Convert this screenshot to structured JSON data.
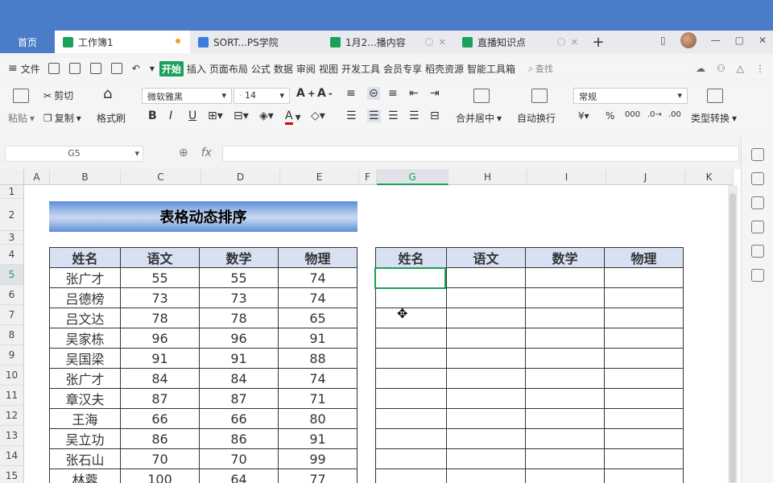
{
  "tabs": {
    "home": "首页",
    "active": "工作簿1",
    "t2": "SORT...PS学院",
    "t3": "1月2...播内容",
    "t4": "直播知识点"
  },
  "menu": {
    "file": "文件",
    "start": "开始",
    "items": [
      "插入",
      "页面布局",
      "公式",
      "数据",
      "审阅",
      "视图",
      "开发工具",
      "会员专享",
      "稻壳资源",
      "智能工具箱"
    ],
    "search": "查找"
  },
  "ribbon": {
    "cut": "剪切",
    "paste": "粘贴",
    "copy": "复制",
    "format_painter": "格式刷",
    "font": "微软雅黑",
    "size": "14",
    "merge": "合并居中",
    "wrap": "自动换行",
    "number_format": "常规",
    "convert": "类型转换",
    "bold": "B",
    "italic": "I",
    "underline": "U"
  },
  "formula": {
    "namebox": "G5",
    "fx": "fx"
  },
  "columns": [
    "A",
    "B",
    "C",
    "D",
    "E",
    "F",
    "G",
    "H",
    "I",
    "J",
    "K"
  ],
  "rows": [
    "1",
    "2",
    "3",
    "4",
    "5",
    "6",
    "7",
    "8",
    "9",
    "10",
    "11",
    "12",
    "13",
    "14",
    "15"
  ],
  "sheet": {
    "title": "表格动态排序",
    "headers": [
      "姓名",
      "语文",
      "数学",
      "物理"
    ],
    "data": [
      [
        "张广才",
        "55",
        "55",
        "74"
      ],
      [
        "吕德榜",
        "73",
        "73",
        "74"
      ],
      [
        "吕文达",
        "78",
        "78",
        "65"
      ],
      [
        "吴家栋",
        "96",
        "96",
        "91"
      ],
      [
        "吴国梁",
        "91",
        "91",
        "88"
      ],
      [
        "张广才",
        "84",
        "84",
        "74"
      ],
      [
        "章汉夫",
        "87",
        "87",
        "71"
      ],
      [
        "王海",
        "66",
        "66",
        "80"
      ],
      [
        "吴立功",
        "86",
        "86",
        "91"
      ],
      [
        "张石山",
        "70",
        "70",
        "99"
      ],
      [
        "林蓉",
        "100",
        "64",
        "77"
      ]
    ],
    "right_headers": [
      "姓名",
      "语文",
      "数学",
      "物理"
    ]
  },
  "colors": {
    "accent": "#1aa05a",
    "brand": "#4a7cc7",
    "header_fill": "#d7e1f2"
  }
}
